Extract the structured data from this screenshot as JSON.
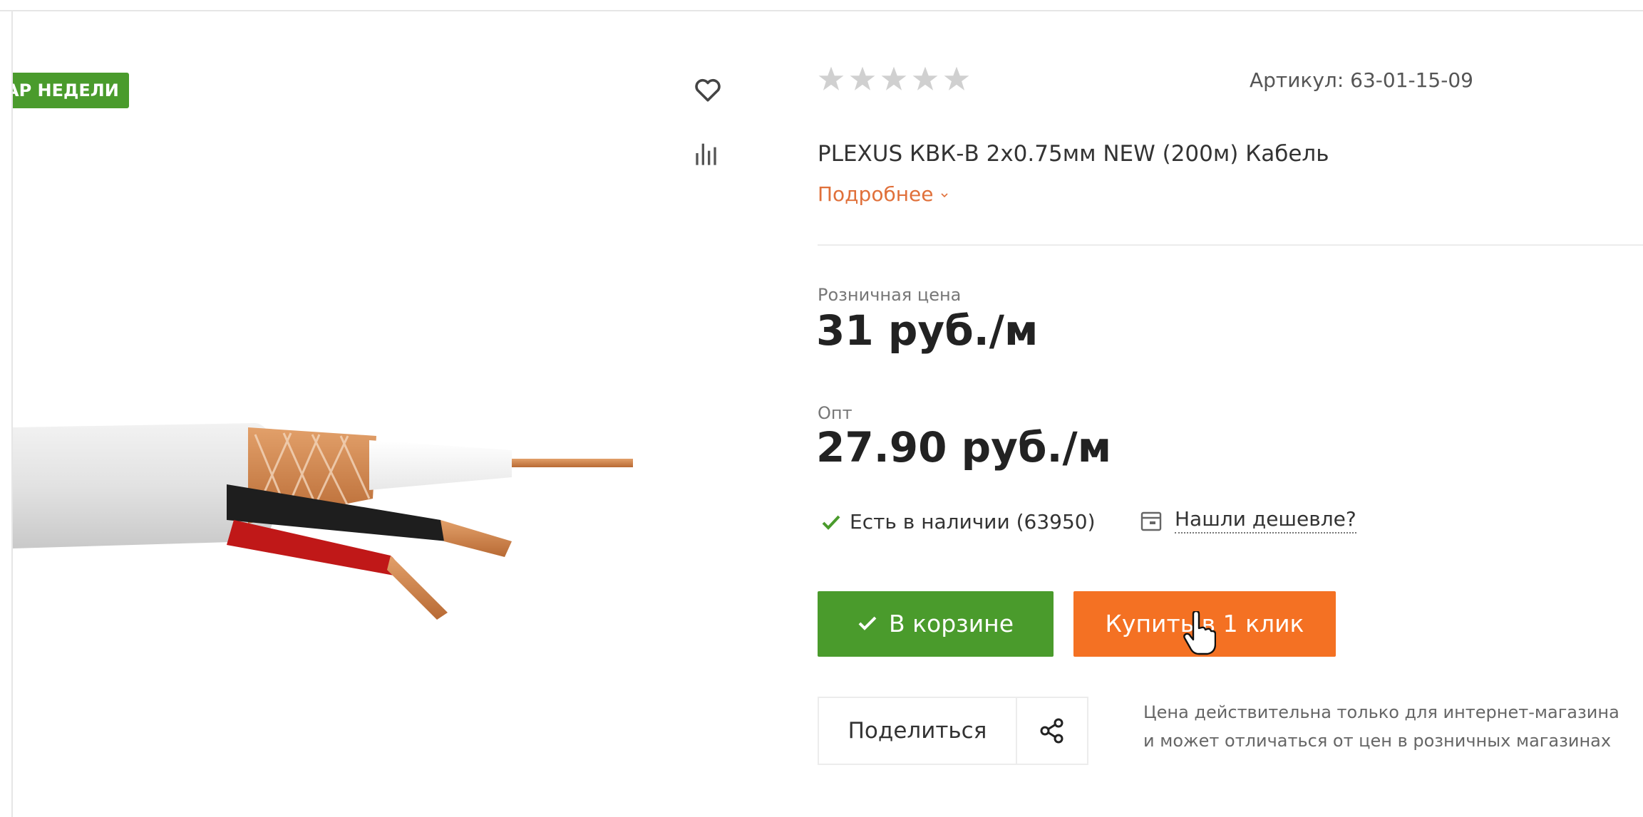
{
  "badge": {
    "label": "АР НЕДЕЛИ"
  },
  "product": {
    "sku_label": "Артикул: 63-01-15-09",
    "title": "PLEXUS КВК-В 2x0.75мм NEW (200м) Кабель",
    "more_link": "Подробнее",
    "rating": {
      "value": 0,
      "max": 5
    }
  },
  "prices": {
    "retail_label": "Розничная цена",
    "retail_value": "31 руб./м",
    "wholesale_label": "Опт",
    "wholesale_value": "27.90 руб./м"
  },
  "availability": {
    "stock_text": "Есть в наличии (63950)",
    "cheaper_link": "Нашли дешевле?"
  },
  "actions": {
    "cart_button": "В корзине",
    "one_click_button": "Купить в 1 клик",
    "share_label": "Поделиться"
  },
  "note": {
    "line1": "Цена действительна только для интернет-магазина",
    "line2": "и может отличаться от цен в розничных магазинах"
  },
  "colors": {
    "green": "#4a9b2c",
    "orange": "#f47123",
    "link_orange": "#e0703a",
    "star_gray": "#d0d0d0"
  },
  "icons": {
    "favorite": "heart-icon",
    "compare": "bar-chart-icon",
    "share": "share-icon",
    "cheaper": "wallet-icon",
    "stock": "check-icon"
  }
}
